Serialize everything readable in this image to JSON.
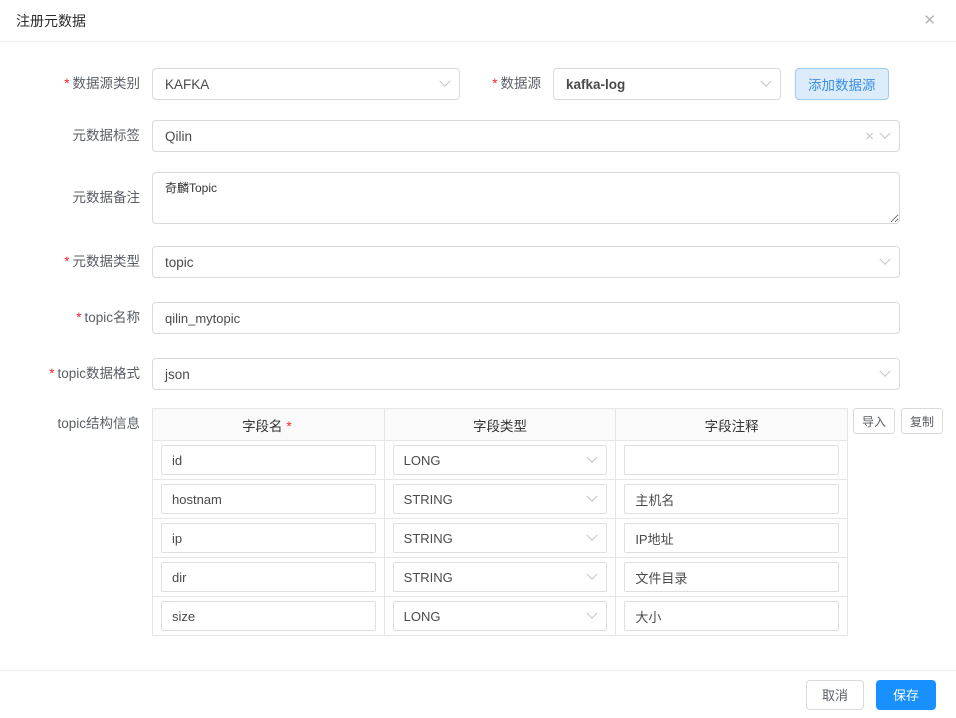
{
  "dialog": {
    "title": "注册元数据",
    "close_icon": "✕"
  },
  "form": {
    "source_category": {
      "star": "*",
      "label": "数据源类别",
      "value": "KAFKA"
    },
    "source": {
      "star": "*",
      "label": "数据源",
      "value": "kafka-log"
    },
    "add_source_button": "添加数据源",
    "meta_tag": {
      "label": "元数据标签",
      "value": "Qilin",
      "clear_icon": "×"
    },
    "meta_remark": {
      "label": "元数据备注",
      "value": "奇麟Topic"
    },
    "meta_type": {
      "star": "*",
      "label": "元数据类型",
      "value": "topic"
    },
    "topic_name": {
      "star": "*",
      "label": "topic名称",
      "value": "qilin_mytopic"
    },
    "topic_format": {
      "star": "*",
      "label": "topic数据格式",
      "value": "json"
    },
    "topic_struct_label": "topic结构信息"
  },
  "table": {
    "headers": {
      "name": "字段名",
      "name_star": "*",
      "type": "字段类型",
      "comment": "字段注释"
    },
    "rows": [
      {
        "name": "id",
        "type": "LONG",
        "comment": ""
      },
      {
        "name": "hostnam",
        "type": "STRING",
        "comment": "主机名"
      },
      {
        "name": "ip",
        "type": "STRING",
        "comment": "IP地址"
      },
      {
        "name": "dir",
        "type": "STRING",
        "comment": "文件目录"
      },
      {
        "name": "size",
        "type": "LONG",
        "comment": "大小"
      }
    ],
    "import_button": "导入",
    "copy_button": "复制"
  },
  "footer": {
    "cancel_button": "取消",
    "save_button": "保存"
  },
  "colors": {
    "primary": "#1890ff",
    "required": "#f5222d"
  }
}
